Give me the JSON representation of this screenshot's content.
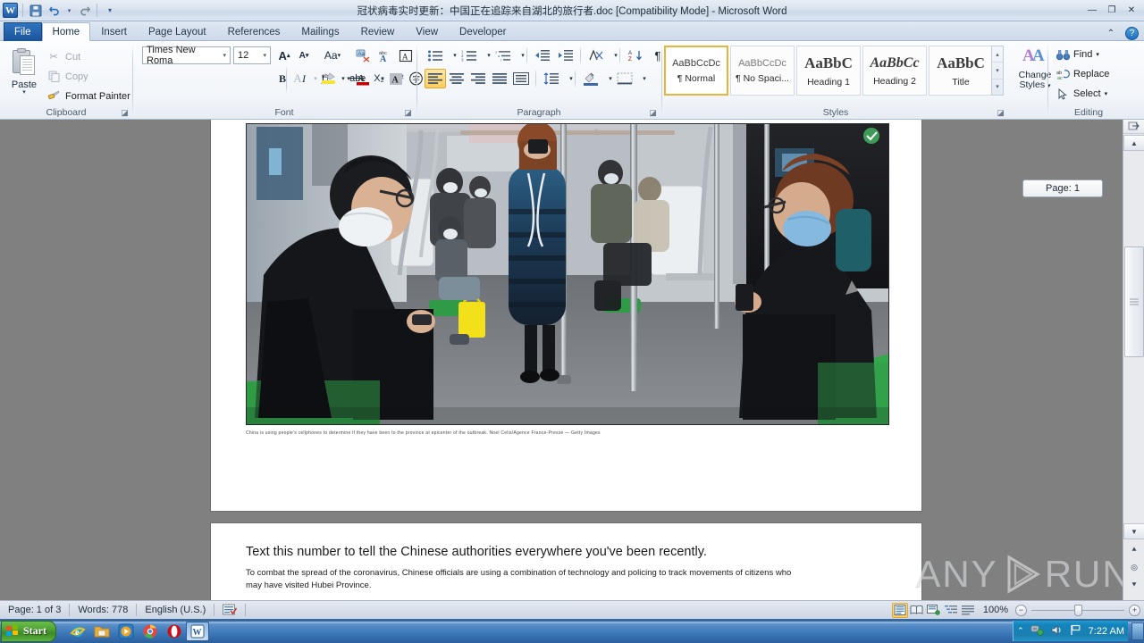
{
  "window": {
    "title": "冠状病毒实时更新：中国正在追踪来自湖北的旅行者.doc [Compatibility Mode]  -  Microsoft Word",
    "app_badge": "W",
    "minimize": "—",
    "restore": "❐",
    "close": "✕",
    "ribbon_collapse": "⌃",
    "help": "?"
  },
  "quick_access": {
    "save_name": "save-icon",
    "undo_name": "undo-icon",
    "redo_name": "redo-icon",
    "customize_name": "customize-qat-icon"
  },
  "tabs": [
    {
      "label": "File",
      "state": "file"
    },
    {
      "label": "Home",
      "state": "active"
    },
    {
      "label": "Insert",
      "state": "normal"
    },
    {
      "label": "Page Layout",
      "state": "normal"
    },
    {
      "label": "References",
      "state": "normal"
    },
    {
      "label": "Mailings",
      "state": "normal"
    },
    {
      "label": "Review",
      "state": "normal"
    },
    {
      "label": "View",
      "state": "normal"
    },
    {
      "label": "Developer",
      "state": "normal"
    }
  ],
  "ribbon": {
    "clipboard": {
      "group_label": "Clipboard",
      "paste_label": "Paste",
      "cut_label": "Cut",
      "copy_label": "Copy",
      "format_painter_label": "Format Painter"
    },
    "font": {
      "group_label": "Font",
      "font_name": "Times New Roma",
      "font_name_full": "Times New Roman",
      "font_size": "12",
      "grow_font": "A",
      "shrink_font": "A",
      "change_case": "Aa",
      "clear_formatting": "clear-formatting-icon",
      "phonetic_guide": "phonetic-guide-icon",
      "character_border": "A",
      "bold": "B",
      "italic": "I",
      "underline": "U",
      "strikethrough": "abc",
      "subscript": "X₂",
      "superscript": "X²",
      "text_effects": "A",
      "highlight": "ab",
      "font_color": "A",
      "shading": "A",
      "enclose_characters": "字"
    },
    "paragraph": {
      "group_label": "Paragraph",
      "bullets": "bullets-icon",
      "numbering": "numbering-icon",
      "multilevel": "multilevel-list-icon",
      "decrease_indent": "decrease-indent-icon",
      "increase_indent": "increase-indent-icon",
      "asian_layout": "asian-layout-icon",
      "sort": "sort-icon",
      "show_marks": "¶",
      "align_left": "align-left-icon",
      "align_center": "align-center-icon",
      "align_right": "align-right-icon",
      "justify": "justify-icon",
      "distributed": "distributed-icon",
      "line_spacing": "line-spacing-icon",
      "shading": "shading-icon",
      "borders": "borders-icon",
      "selected_alignment": "align_left"
    },
    "styles": {
      "group_label": "Styles",
      "items": [
        {
          "preview": "AaBbCcDc",
          "name": "¶ Normal",
          "selected": true
        },
        {
          "preview": "AaBbCcDc",
          "name": "¶ No Spaci...",
          "selected": false
        },
        {
          "preview": "AaBbC",
          "name": "Heading 1",
          "selected": false
        },
        {
          "preview": "AaBbCc",
          "name": "Heading 2",
          "selected": false
        },
        {
          "preview": "AaBbC",
          "name": "Title",
          "selected": false
        }
      ],
      "change_styles_label": "Change\nStyles"
    },
    "editing": {
      "group_label": "Editing",
      "find_label": "Find",
      "replace_label": "Replace",
      "select_label": "Select"
    }
  },
  "document": {
    "image_alt": "subway-car-passengers-wearing-masks-photo",
    "caption": "China is using people's cellphones to determine if they have been to the province at epicenter of the outbreak.  Noel Celis/Agence France-Presse — Getty Images",
    "page2_heading": "Text this number to tell the Chinese authorities everywhere you've been recently.",
    "page2_body": "To combat the spread of the coronavirus, Chinese officials are using a combination of technology and policing to track movements of citizens who may have visited Hubei Province."
  },
  "tooltip": {
    "page_indicator": "Page: 1"
  },
  "status_bar": {
    "page": "Page: 1 of 3",
    "words": "Words: 778",
    "language": "English (U.S.)",
    "proofing_icon": "spelling-grammar-icon",
    "zoom": "100%",
    "zoom_out": "−",
    "zoom_in": "+",
    "views": [
      {
        "name": "print-layout-view",
        "selected": true
      },
      {
        "name": "full-screen-reading-view",
        "selected": false
      },
      {
        "name": "web-layout-view",
        "selected": false
      },
      {
        "name": "outline-view",
        "selected": false
      },
      {
        "name": "draft-view",
        "selected": false
      }
    ]
  },
  "taskbar": {
    "start_label": "Start",
    "quick_launch": [
      {
        "name": "internet-explorer-icon"
      },
      {
        "name": "file-explorer-icon"
      },
      {
        "name": "media-player-icon"
      },
      {
        "name": "chrome-icon"
      },
      {
        "name": "opera-icon"
      }
    ],
    "active_task": {
      "name": "word-taskbar-button",
      "label": "W"
    },
    "tray": {
      "hidden_icons": "hidden-icons-chevron",
      "network": "network-icon",
      "volume": "volume-icon",
      "action_center": "action-center-flag-icon",
      "clock": "7:22 AM",
      "show_desktop": "show-desktop-button"
    }
  },
  "watermark": {
    "left": "ANY",
    "right": "RUN"
  },
  "colors": {
    "accent": "#2f74c0",
    "selection": "#ffcd5c",
    "taskbar": "#3c78b8",
    "start_green": "#4fa134"
  }
}
